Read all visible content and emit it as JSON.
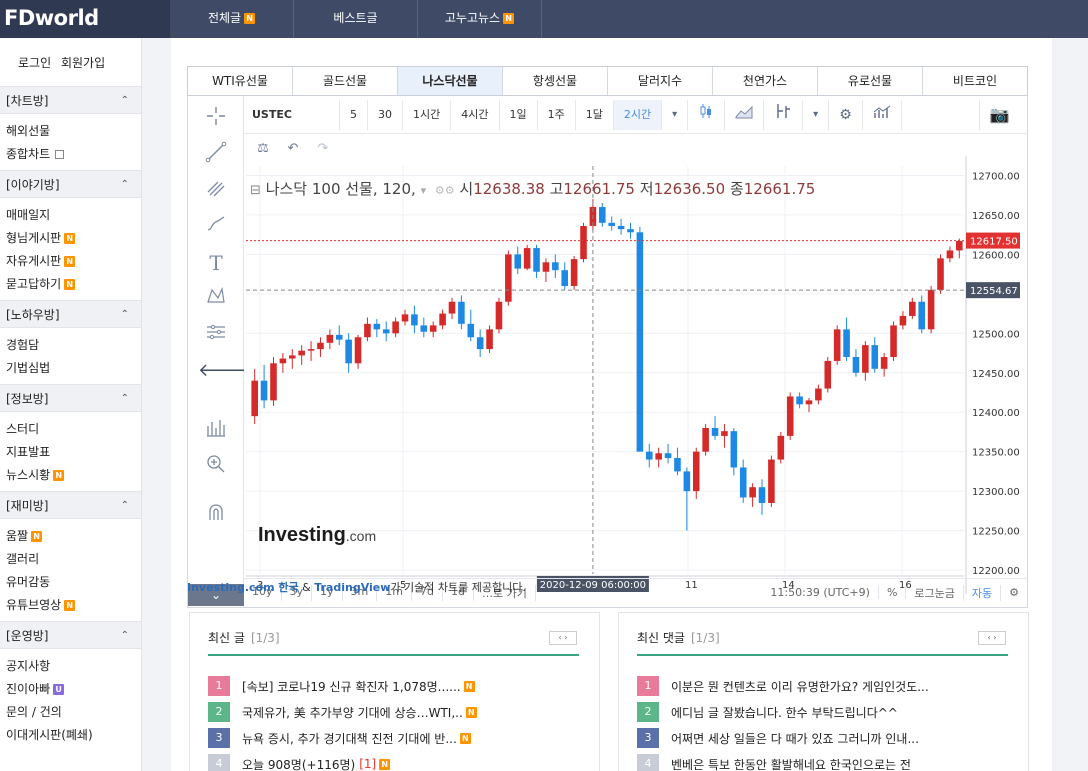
{
  "brand": {
    "logo": "FDworld"
  },
  "topnav": [
    {
      "label": "전체글",
      "badge": "N"
    },
    {
      "label": "베스트글",
      "badge": ""
    },
    {
      "label": "고누고뉴스",
      "badge": "N"
    }
  ],
  "auth": {
    "login": "로그인",
    "signup": "회원가입"
  },
  "sidebar": [
    {
      "title": "[차트방]",
      "items": [
        {
          "label": "해외선물",
          "badge": ""
        },
        {
          "label": "종합차트",
          "badge": "",
          "external": true
        }
      ]
    },
    {
      "title": "[이야기방]",
      "items": [
        {
          "label": "매매일지",
          "badge": ""
        },
        {
          "label": "형님게시판",
          "badge": "N"
        },
        {
          "label": "자유게시판",
          "badge": "N"
        },
        {
          "label": "묻고답하기",
          "badge": "N"
        }
      ]
    },
    {
      "title": "[노하우방]",
      "items": [
        {
          "label": "경험담",
          "badge": ""
        },
        {
          "label": "기법심법",
          "badge": ""
        }
      ]
    },
    {
      "title": "[정보방]",
      "items": [
        {
          "label": "스터디",
          "badge": ""
        },
        {
          "label": "지표발표",
          "badge": ""
        },
        {
          "label": "뉴스시황",
          "badge": "N"
        }
      ]
    },
    {
      "title": "[재미방]",
      "items": [
        {
          "label": "움짤",
          "badge": "N"
        },
        {
          "label": "갤러리",
          "badge": ""
        },
        {
          "label": "유머감동",
          "badge": ""
        },
        {
          "label": "유튜브영상",
          "badge": "N"
        }
      ]
    },
    {
      "title": "[운영방]",
      "items": [
        {
          "label": "공지사항",
          "badge": ""
        },
        {
          "label": "진이아빠",
          "badge": "U"
        },
        {
          "label": "문의 / 건의",
          "badge": ""
        },
        {
          "label": "이대게시판(폐쇄)",
          "badge": ""
        }
      ]
    }
  ],
  "tabs": [
    "WTI유선물",
    "골드선물",
    "나스닥선물",
    "항셍선물",
    "달러지수",
    "천연가스",
    "유로선물",
    "비트코인"
  ],
  "active_tab": 2,
  "toolbar": {
    "symbol": "USTEC",
    "intervals": [
      "5",
      "30",
      "1시간",
      "4시간",
      "1일",
      "1주",
      "1달",
      "2시간"
    ],
    "active_interval": 7
  },
  "chart_header": {
    "title": "나스닥 100 선물, 120,",
    "o_label": "시",
    "o": "12638.38",
    "h_label": "고",
    "h": "12661.75",
    "l_label": "저",
    "l": "12636.50",
    "c_label": "종",
    "c": "12661.75"
  },
  "watermark": {
    "brand": "Investing",
    "suffix": ".com"
  },
  "chart_data": {
    "type": "candlestick",
    "title": "나스닥 100 선물, 120,",
    "y_ticks": [
      12700,
      12650,
      12600,
      12550,
      12500,
      12450,
      12400,
      12350,
      12300,
      12250,
      12200
    ],
    "ylim": [
      12195,
      12712
    ],
    "y_tick_labels": [
      "12700.00",
      "12650.00",
      "12600.00",
      "12550.00",
      "12500.00",
      "12450.00",
      "12400.00",
      "12350.00",
      "12300.00",
      "12250.00",
      "12200.00"
    ],
    "x_tick_labels": [
      "3",
      "5",
      "11",
      "14",
      "16"
    ],
    "crosshair_x_label": "2020-12-09 06:00:00",
    "crosshair_y_label": "12554.67",
    "last_price_label": "12617.50",
    "colors": {
      "up": "#d42a2a",
      "down": "#1e88e5",
      "last_line": "#e23131"
    },
    "candles": [
      [
        12395,
        12455,
        12385,
        12440
      ],
      [
        12440,
        12460,
        12405,
        12415
      ],
      [
        12415,
        12470,
        12408,
        12462
      ],
      [
        12462,
        12475,
        12450,
        12468
      ],
      [
        12468,
        12480,
        12455,
        12472
      ],
      [
        12472,
        12485,
        12460,
        12478
      ],
      [
        12478,
        12490,
        12465,
        12480
      ],
      [
        12480,
        12495,
        12470,
        12488
      ],
      [
        12488,
        12505,
        12480,
        12498
      ],
      [
        12498,
        12510,
        12485,
        12492
      ],
      [
        12492,
        12500,
        12450,
        12462
      ],
      [
        12462,
        12498,
        12455,
        12495
      ],
      [
        12495,
        12520,
        12490,
        12512
      ],
      [
        12512,
        12518,
        12495,
        12505
      ],
      [
        12505,
        12515,
        12490,
        12500
      ],
      [
        12500,
        12520,
        12495,
        12515
      ],
      [
        12515,
        12530,
        12510,
        12524
      ],
      [
        12524,
        12535,
        12500,
        12510
      ],
      [
        12510,
        12520,
        12495,
        12502
      ],
      [
        12502,
        12515,
        12495,
        12510
      ],
      [
        12510,
        12530,
        12505,
        12525
      ],
      [
        12525,
        12545,
        12518,
        12540
      ],
      [
        12540,
        12548,
        12505,
        12512
      ],
      [
        12512,
        12530,
        12490,
        12495
      ],
      [
        12495,
        12505,
        12470,
        12480
      ],
      [
        12480,
        12510,
        12475,
        12505
      ],
      [
        12505,
        12545,
        12500,
        12540
      ],
      [
        12540,
        12605,
        12535,
        12600
      ],
      [
        12600,
        12610,
        12575,
        12582
      ],
      [
        12582,
        12612,
        12580,
        12608
      ],
      [
        12608,
        12612,
        12570,
        12578
      ],
      [
        12578,
        12595,
        12565,
        12590
      ],
      [
        12590,
        12600,
        12570,
        12580
      ],
      [
        12580,
        12590,
        12555,
        12560
      ],
      [
        12560,
        12598,
        12555,
        12594
      ],
      [
        12594,
        12640,
        12590,
        12636
      ],
      [
        12636,
        12670,
        12630,
        12660
      ],
      [
        12660,
        12665,
        12635,
        12640
      ],
      [
        12640,
        12648,
        12630,
        12636
      ],
      [
        12636,
        12645,
        12625,
        12632
      ],
      [
        12632,
        12640,
        12620,
        12628
      ],
      [
        12628,
        12635,
        12545,
        12350
      ],
      [
        12350,
        12360,
        12330,
        12340
      ],
      [
        12340,
        12355,
        12330,
        12348
      ],
      [
        12348,
        12360,
        12335,
        12342
      ],
      [
        12342,
        12355,
        12320,
        12325
      ],
      [
        12325,
        12330,
        12250,
        12300
      ],
      [
        12300,
        12355,
        12290,
        12350
      ],
      [
        12350,
        12385,
        12345,
        12380
      ],
      [
        12380,
        12395,
        12365,
        12370
      ],
      [
        12370,
        12385,
        12355,
        12376
      ],
      [
        12376,
        12380,
        12320,
        12330
      ],
      [
        12330,
        12340,
        12285,
        12292
      ],
      [
        12292,
        12310,
        12280,
        12305
      ],
      [
        12305,
        12315,
        12270,
        12285
      ],
      [
        12285,
        12345,
        12280,
        12340
      ],
      [
        12340,
        12375,
        12335,
        12370
      ],
      [
        12370,
        12425,
        12365,
        12420
      ],
      [
        12420,
        12425,
        12405,
        12410
      ],
      [
        12410,
        12418,
        12400,
        12415
      ],
      [
        12415,
        12435,
        12410,
        12430
      ],
      [
        12430,
        12470,
        12425,
        12465
      ],
      [
        12465,
        12510,
        12460,
        12505
      ],
      [
        12505,
        12520,
        12465,
        12470
      ],
      [
        12470,
        12480,
        12445,
        12450
      ],
      [
        12450,
        12490,
        12440,
        12485
      ],
      [
        12485,
        12495,
        12450,
        12455
      ],
      [
        12455,
        12475,
        12445,
        12470
      ],
      [
        12470,
        12515,
        12465,
        12510
      ],
      [
        12510,
        12528,
        12505,
        12522
      ],
      [
        12522,
        12545,
        12518,
        12540
      ],
      [
        12540,
        12548,
        12500,
        12505
      ],
      [
        12505,
        12560,
        12500,
        12555
      ],
      [
        12555,
        12600,
        12550,
        12595
      ],
      [
        12595,
        12610,
        12590,
        12605
      ],
      [
        12605,
        12620,
        12595,
        12617
      ]
    ]
  },
  "bottom_ranges": [
    "10y",
    "3y",
    "1y",
    "3m",
    "1m",
    "7d",
    "1d",
    "…로 가기"
  ],
  "bottom_right": {
    "time": "11:50:39 (UTC+9)",
    "percent": "%",
    "log": "로그눈금",
    "auto": "자동"
  },
  "credit": {
    "investing": "Investing.com 한국",
    "amp": "&",
    "tv": "TradingView",
    "suffix": "가 기술적 차트를 제공합니다."
  },
  "panels": {
    "latest_posts": {
      "title": "최신 글",
      "count": "[1/3]",
      "rows": [
        {
          "n": "1",
          "text": "[속보] 코로나19 신규 확진자 1,078명......",
          "badge": "N",
          "extra": ""
        },
        {
          "n": "2",
          "text": "국제유가, 美 추가부양 기대에 상승…WTI,..",
          "badge": "N",
          "extra": ""
        },
        {
          "n": "3",
          "text": "뉴욕 증시, 추가 경기대책 진전 기대에 반...",
          "badge": "N",
          "extra": ""
        },
        {
          "n": "4",
          "text": "오늘 908명(+116명)",
          "badge": "N",
          "extra": "[1]"
        }
      ]
    },
    "latest_comments": {
      "title": "최신 댓글",
      "count": "[1/3]",
      "rows": [
        {
          "n": "1",
          "text": "이분은 뭔 컨텐츠로 이리 유명한가요? 게임인것도...",
          "badge": "",
          "extra": ""
        },
        {
          "n": "2",
          "text": "에디님 글 잘봤습니다. 한수 부탁드립니다^^",
          "badge": "",
          "extra": ""
        },
        {
          "n": "3",
          "text": "어쩌면 세상 일들은 다 때가 있죠 그러니까 인내...",
          "badge": "",
          "extra": ""
        },
        {
          "n": "4",
          "text": "벤베은 특보 한동안 활발해네요 한국인으로는 전",
          "badge": "",
          "extra": ""
        }
      ]
    }
  }
}
